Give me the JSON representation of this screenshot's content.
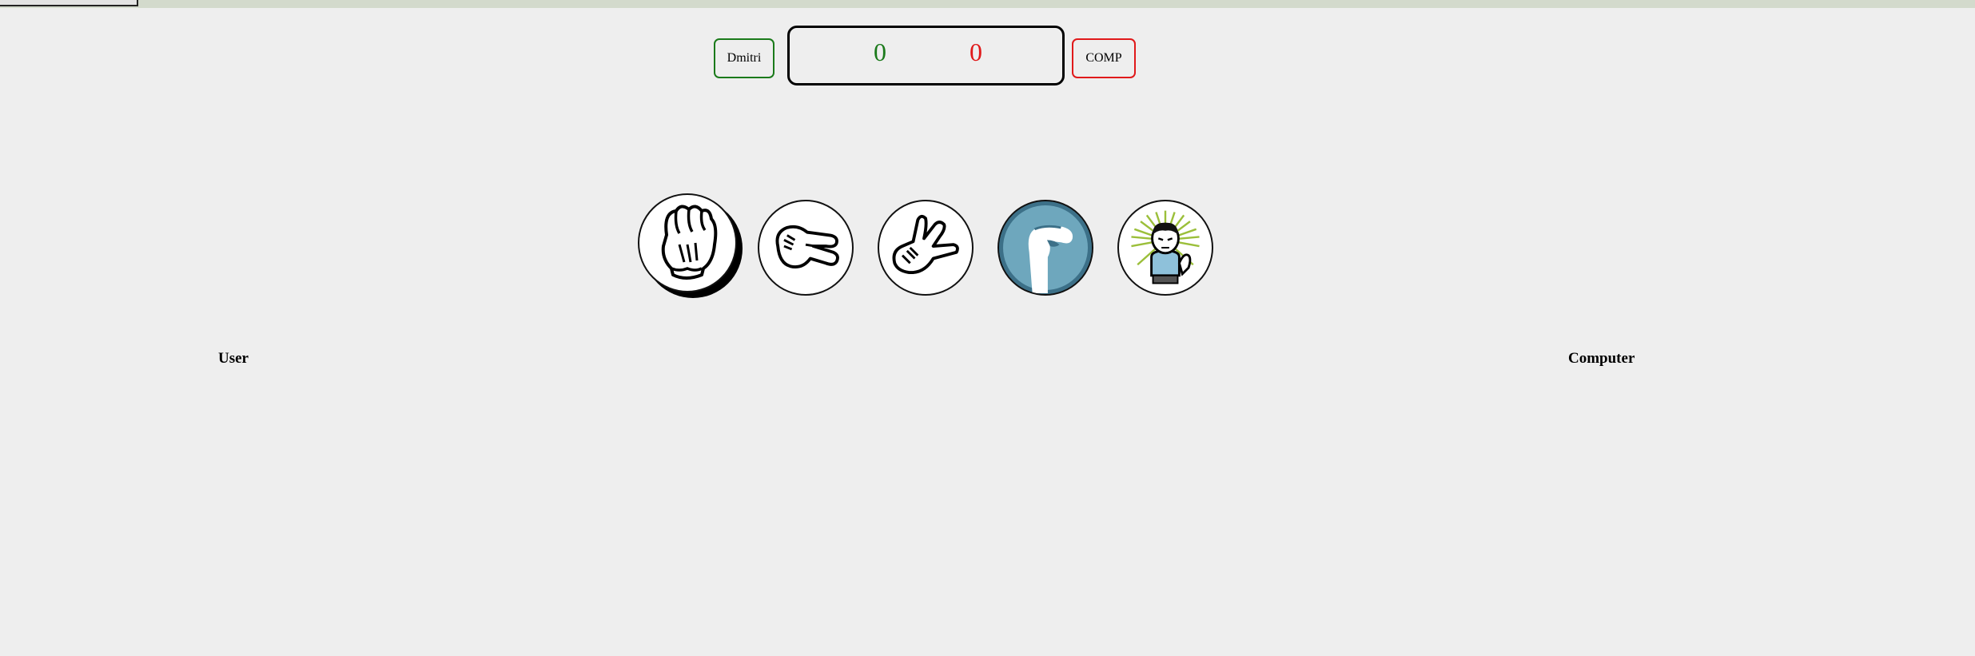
{
  "header": {
    "user_name": "Dmitri",
    "comp_name": "COMP"
  },
  "scoreboard": {
    "user_score": "0",
    "comp_score": "0",
    "user_color": "#1b7a1b",
    "comp_color": "#e0191a"
  },
  "choices": [
    {
      "id": "rock",
      "icon": "rock-fist-icon",
      "selected": true
    },
    {
      "id": "paper",
      "icon": "paper-hand-icon"
    },
    {
      "id": "scissors",
      "icon": "scissors-hand-icon"
    },
    {
      "id": "lizard",
      "icon": "lizard-hand-icon"
    },
    {
      "id": "spock",
      "icon": "spock-icon"
    }
  ],
  "labels": {
    "user": "User",
    "computer": "Computer"
  },
  "colors": {
    "background": "#eeeeee",
    "top_strip": "#d3dacc",
    "lizard_bg": "#6ea7bd",
    "spock_burst": "#9bbf3a"
  }
}
